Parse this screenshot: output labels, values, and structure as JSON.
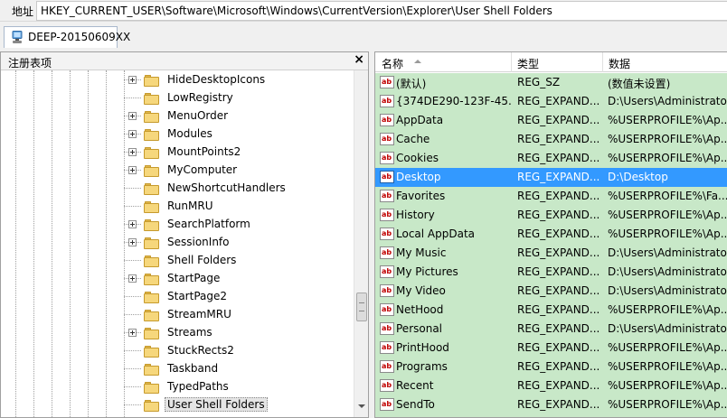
{
  "address_bar": {
    "label": "地址",
    "path": "HKEY_CURRENT_USER\\Software\\Microsoft\\Windows\\CurrentVersion\\Explorer\\User Shell Folders"
  },
  "tab": {
    "label": "DEEP-20150609XX",
    "icon": "computer-registry-icon"
  },
  "tree_panel": {
    "title": "注册表项",
    "close_label": "×",
    "items": [
      {
        "label": "HideDesktopIcons",
        "has_children": true
      },
      {
        "label": "LowRegistry",
        "has_children": false
      },
      {
        "label": "MenuOrder",
        "has_children": true
      },
      {
        "label": "Modules",
        "has_children": true
      },
      {
        "label": "MountPoints2",
        "has_children": true
      },
      {
        "label": "MyComputer",
        "has_children": true
      },
      {
        "label": "NewShortcutHandlers",
        "has_children": false
      },
      {
        "label": "RunMRU",
        "has_children": false
      },
      {
        "label": "SearchPlatform",
        "has_children": true
      },
      {
        "label": "SessionInfo",
        "has_children": true
      },
      {
        "label": "Shell Folders",
        "has_children": false
      },
      {
        "label": "StartPage",
        "has_children": true
      },
      {
        "label": "StartPage2",
        "has_children": false
      },
      {
        "label": "StreamMRU",
        "has_children": false
      },
      {
        "label": "Streams",
        "has_children": true
      },
      {
        "label": "StuckRects2",
        "has_children": false
      },
      {
        "label": "Taskband",
        "has_children": false
      },
      {
        "label": "TypedPaths",
        "has_children": false
      },
      {
        "label": "User Shell Folders",
        "has_children": false,
        "selected": true
      }
    ]
  },
  "values_panel": {
    "columns": {
      "name": "名称",
      "type": "类型",
      "data": "数据"
    },
    "icon_text": "ab",
    "rows": [
      {
        "name": "(默认)",
        "type": "REG_SZ",
        "data": "(数值未设置)"
      },
      {
        "name": "{374DE290-123F-45...",
        "type": "REG_EXPAND...",
        "data": "D:\\Users\\Administrato..."
      },
      {
        "name": "AppData",
        "type": "REG_EXPAND...",
        "data": "%USERPROFILE%\\Ap..."
      },
      {
        "name": "Cache",
        "type": "REG_EXPAND...",
        "data": "%USERPROFILE%\\Ap..."
      },
      {
        "name": "Cookies",
        "type": "REG_EXPAND...",
        "data": "%USERPROFILE%\\Ap..."
      },
      {
        "name": "Desktop",
        "type": "REG_EXPAND...",
        "data": "D:\\Desktop",
        "selected": true
      },
      {
        "name": "Favorites",
        "type": "REG_EXPAND...",
        "data": "%USERPROFILE%\\Fa..."
      },
      {
        "name": "History",
        "type": "REG_EXPAND...",
        "data": "%USERPROFILE%\\Ap..."
      },
      {
        "name": "Local AppData",
        "type": "REG_EXPAND...",
        "data": "%USERPROFILE%\\Ap..."
      },
      {
        "name": "My Music",
        "type": "REG_EXPAND...",
        "data": "D:\\Users\\Administrato..."
      },
      {
        "name": "My Pictures",
        "type": "REG_EXPAND...",
        "data": "D:\\Users\\Administrato..."
      },
      {
        "name": "My Video",
        "type": "REG_EXPAND...",
        "data": "D:\\Users\\Administrato..."
      },
      {
        "name": "NetHood",
        "type": "REG_EXPAND...",
        "data": "%USERPROFILE%\\Ap..."
      },
      {
        "name": "Personal",
        "type": "REG_EXPAND...",
        "data": "D:\\Users\\Administrato..."
      },
      {
        "name": "PrintHood",
        "type": "REG_EXPAND...",
        "data": "%USERPROFILE%\\Ap..."
      },
      {
        "name": "Programs",
        "type": "REG_EXPAND...",
        "data": "%USERPROFILE%\\Ap..."
      },
      {
        "name": "Recent",
        "type": "REG_EXPAND...",
        "data": "%USERPROFILE%\\Ap..."
      },
      {
        "name": "SendTo",
        "type": "REG_EXPAND...",
        "data": "%USERPROFILE%\\Ap..."
      }
    ]
  },
  "colors": {
    "values_background": "#c8e8c8",
    "selection": "#3399ff",
    "folder": "#f6d77c"
  }
}
